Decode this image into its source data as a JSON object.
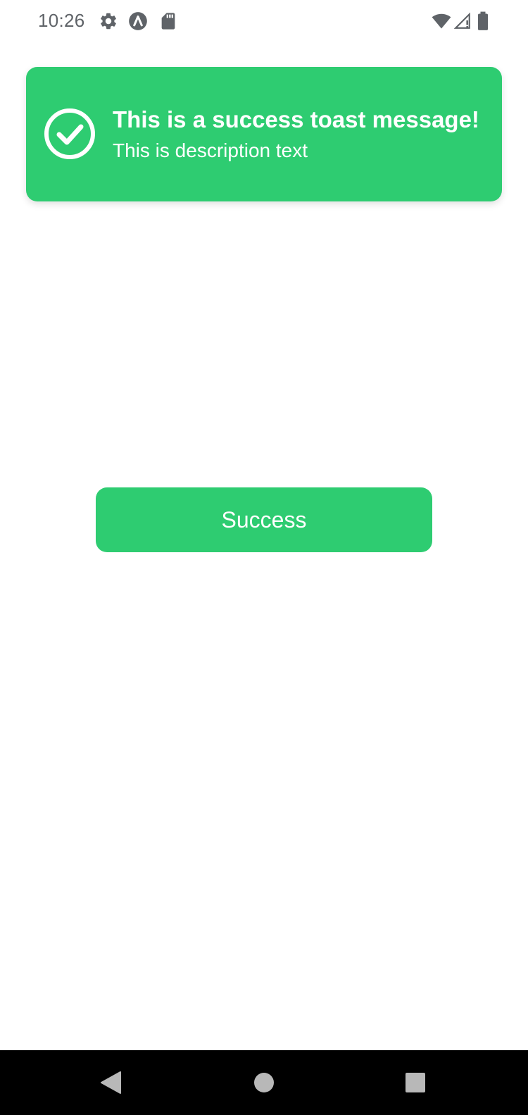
{
  "status_bar": {
    "time": "10:26",
    "left_icons": [
      "settings-gear-icon",
      "app-a-icon",
      "sd-card-icon"
    ],
    "right_icons": [
      "wifi-icon",
      "cellular-signal-icon",
      "battery-icon"
    ],
    "icon_color": "#5f6368"
  },
  "toast": {
    "title": "This is a success toast message!",
    "description": "This is description text",
    "icon": "check-circle-icon",
    "background_color": "#2ecc71",
    "text_color": "#ffffff"
  },
  "main": {
    "success_button_label": "Success",
    "button_color": "#2ecc71"
  },
  "nav_bar": {
    "buttons": [
      "back-icon",
      "home-icon",
      "recents-icon"
    ],
    "background_color": "#000000"
  }
}
